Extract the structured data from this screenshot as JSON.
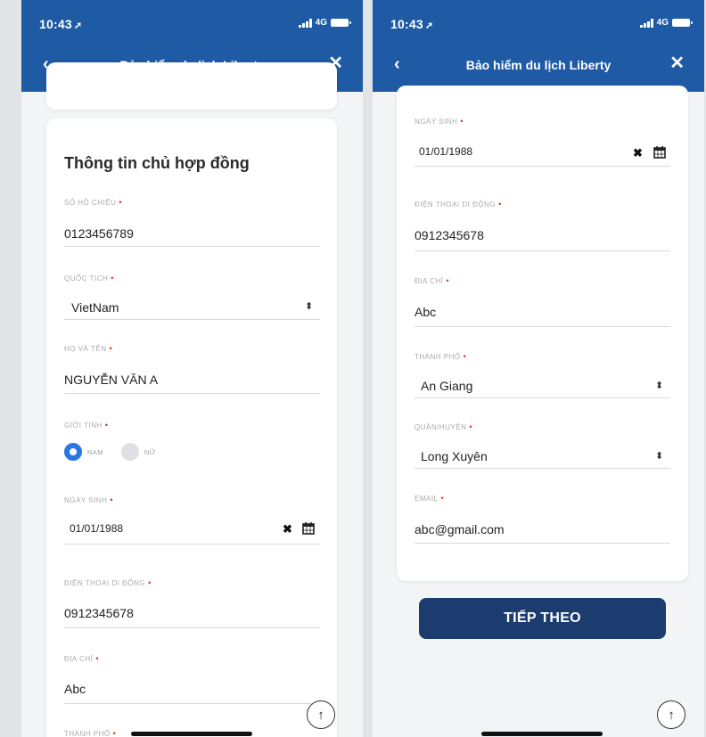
{
  "status": {
    "time": "10:43",
    "network": "4G"
  },
  "nav": {
    "back_icon": "‹",
    "title": "Bảo hiểm du lịch Liberty",
    "close_icon": "✕"
  },
  "left_screen": {
    "section_title": "Thông tin chủ hợp đồng",
    "passport": {
      "label": "SỐ HỘ CHIẾU",
      "value": "0123456789"
    },
    "nationality": {
      "label": "QUỐC TỊCH",
      "value": "VietNam"
    },
    "full_name": {
      "label": "HỌ VÀ TÊN",
      "value": "NGUYỄN VĂN A"
    },
    "gender": {
      "label": "GIỚI TÍNH",
      "options": [
        "NAM",
        "NỮ"
      ],
      "selected": "NAM"
    },
    "dob": {
      "label": "NGÀY SINH",
      "value": "01/01/1988"
    },
    "phone": {
      "label": "ĐIỆN THOẠI DI ĐỘNG",
      "value": "0912345678"
    },
    "address": {
      "label": "ĐỊA CHỈ",
      "value": "Abc"
    },
    "city": {
      "label": "THÀNH PHỐ"
    }
  },
  "right_screen": {
    "dob": {
      "label": "NGÀY SINH",
      "value": "01/01/1988"
    },
    "phone": {
      "label": "ĐIỆN THOẠI DI ĐỘNG",
      "value": "0912345678"
    },
    "address": {
      "label": "ĐỊA CHỈ",
      "value": "Abc"
    },
    "city": {
      "label": "THÀNH PHỐ",
      "value": "An Giang"
    },
    "district": {
      "label": "QUẬN/HUYỆN",
      "value": "Long Xuyên"
    },
    "email": {
      "label": "EMAIL",
      "value": "abc@gmail.com"
    },
    "next_button": "TIẾP THEO"
  },
  "icons": {
    "back": "chevron-left-icon",
    "close": "close-icon",
    "select": "select-updown-icon",
    "clear": "clear-x-icon",
    "calendar": "calendar-icon",
    "scroll_top": "arrow-up-icon"
  },
  "colors": {
    "header": "#1f5aa5",
    "button": "#1c3c70",
    "radio_selected": "#2a77e3",
    "required": "#e02424"
  }
}
